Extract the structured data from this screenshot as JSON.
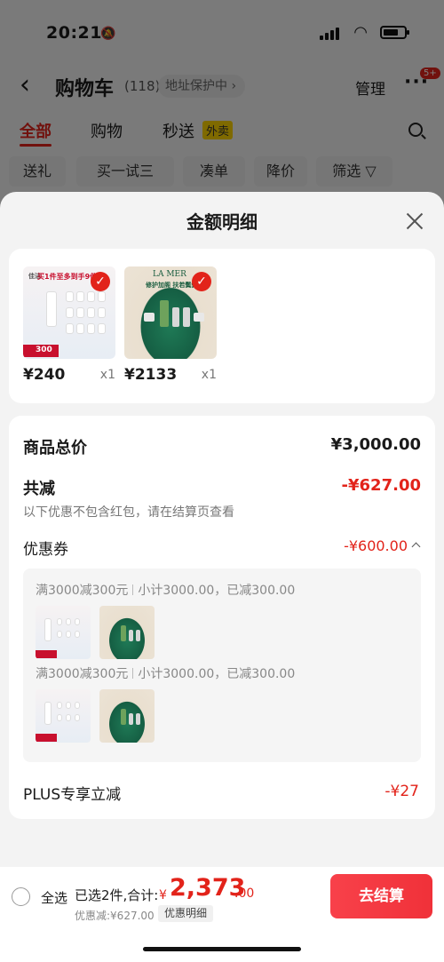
{
  "status_bar": {
    "time": "20:21"
  },
  "nav": {
    "back_icon": "chevron-left-icon",
    "title": "购物车",
    "count": "(118)",
    "address": "地址保护中 ›",
    "manage": "管理",
    "more": "···",
    "badge": "5+"
  },
  "tabs": [
    {
      "label": "全部"
    },
    {
      "label": "购物"
    },
    {
      "label": "秒送"
    }
  ],
  "tab_tag": "外卖",
  "chips": [
    {
      "label": "送礼"
    },
    {
      "label": "买一试三"
    },
    {
      "label": "凑单"
    },
    {
      "label": "降价"
    },
    {
      "label": "筛选 ▽"
    }
  ],
  "sheet": {
    "title": "金额明细",
    "products": [
      {
        "price": "¥240",
        "qty": "x1",
        "brand": "white-skincare-set",
        "promo_line": "买1件至多到手9件",
        "deal": "300"
      },
      {
        "price": "¥2133",
        "qty": "x1",
        "brand": "LA MER",
        "promo_line": "修护加阁 扶若鬓鬓"
      }
    ],
    "total_label": "商品总价",
    "total_value": "¥3,000.00",
    "reduce_label": "共减",
    "reduce_value": "-¥627.00",
    "note": "以下优惠不包含红包，请在结算页查看",
    "coupon_label": "优惠券",
    "coupon_value": "-¥600.00",
    "coupon_groups": [
      {
        "rule": "满3000减300元",
        "summary": "小计3000.00，已减300.00"
      },
      {
        "rule": "满3000减300元",
        "summary": "小计3000.00，已减300.00"
      }
    ],
    "plus_label": "PLUS专享立减",
    "plus_value": "-¥27"
  },
  "bottom_bar": {
    "select_all": "全选",
    "selected": "已选2件,合计:",
    "currency": "¥",
    "total_int": "2,373",
    "total_dec": ".00",
    "discount": "优惠减:¥627.00",
    "detail_link": "优惠明细",
    "checkout": "去结算"
  },
  "colors": {
    "accent": "#e2231a",
    "checkout": "#f8414a"
  }
}
